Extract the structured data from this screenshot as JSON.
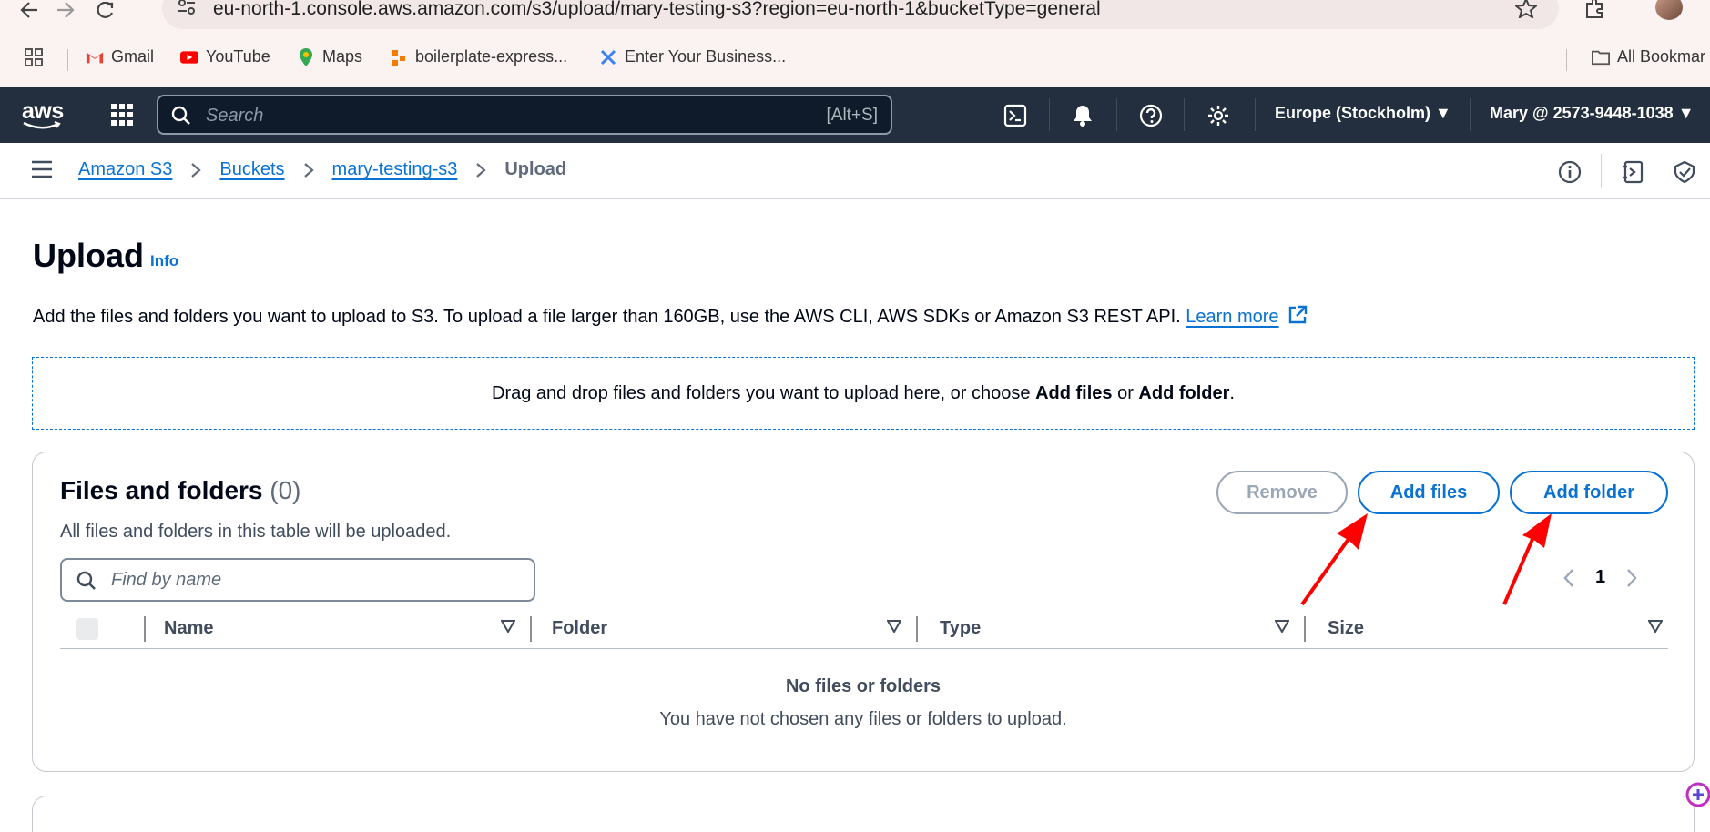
{
  "browser": {
    "url": "eu-north-1.console.aws.amazon.com/s3/upload/mary-testing-s3?region=eu-north-1&bucketType=general",
    "bookmarks": [
      {
        "label": "Gmail",
        "icon": "gmail-icon"
      },
      {
        "label": "YouTube",
        "icon": "youtube-icon"
      },
      {
        "label": "Maps",
        "icon": "maps-icon"
      },
      {
        "label": "boilerplate-express...",
        "icon": "boilerplate-icon"
      },
      {
        "label": "Enter Your Business...",
        "icon": "business-icon"
      }
    ],
    "all_bookmarks_label": "All Bookmar"
  },
  "aws_nav": {
    "logo": "aws",
    "search_placeholder": "Search",
    "search_shortcut": "[Alt+S]",
    "region": "Europe (Stockholm) ▼",
    "account": "Mary @ 2573-9448-1038 ▼"
  },
  "breadcrumb": {
    "items": [
      "Amazon S3",
      "Buckets",
      "mary-testing-s3"
    ],
    "current": "Upload"
  },
  "page": {
    "title": "Upload",
    "info_label": "Info",
    "description": "Add the files and folders you want to upload to S3. To upload a file larger than 160GB, use the AWS CLI, AWS SDKs or Amazon S3 REST API.",
    "learn_more": "Learn more",
    "dropzone_prefix": "Drag and drop files and folders you want to upload here, or choose ",
    "dropzone_add_files": "Add files",
    "dropzone_or": " or ",
    "dropzone_add_folder": "Add folder",
    "dropzone_suffix": "."
  },
  "files_panel": {
    "title": "Files and folders",
    "count": "(0)",
    "description": "All files and folders in this table will be uploaded.",
    "remove_label": "Remove",
    "add_files_label": "Add files",
    "add_folder_label": "Add folder",
    "filter_placeholder": "Find by name",
    "page_number": "1",
    "columns": [
      "Name",
      "Folder",
      "Type",
      "Size"
    ],
    "empty_title": "No files or folders",
    "empty_message": "You have not chosen any files or folders to upload."
  },
  "colors": {
    "aws_nav_bg": "#232f3e",
    "link_blue": "#0972d3",
    "annotation_red": "#ff0000"
  }
}
